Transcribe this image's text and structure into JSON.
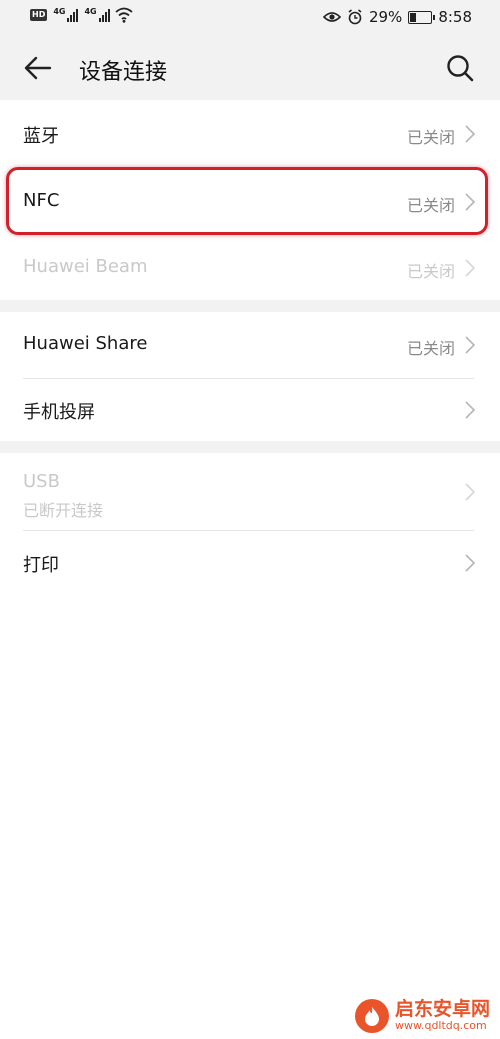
{
  "status_bar": {
    "hd": "HD",
    "sig1_tag": "4G",
    "sig2_tag": "4G",
    "battery_pct": "29%",
    "battery_level": 0.29,
    "time": "8:58"
  },
  "header": {
    "title": "设备连接"
  },
  "rows": {
    "bluetooth": {
      "label": "蓝牙",
      "value": "已关闭"
    },
    "nfc": {
      "label": "NFC",
      "value": "已关闭"
    },
    "huawei_beam": {
      "label": "Huawei Beam",
      "value": "已关闭"
    },
    "huawei_share": {
      "label": "Huawei Share",
      "value": "已关闭"
    },
    "projection": {
      "label": "手机投屏"
    },
    "usb": {
      "label": "USB",
      "sub": "已断开连接"
    },
    "print": {
      "label": "打印"
    }
  },
  "watermark": {
    "title": "启东安卓网",
    "url": "www.qdltdq.com"
  },
  "colors": {
    "highlight": "#d4202b",
    "disabled_text": "#c9c9c9",
    "secondary_text": "#8a8a8a",
    "section_gap": "#f2f2f2"
  }
}
